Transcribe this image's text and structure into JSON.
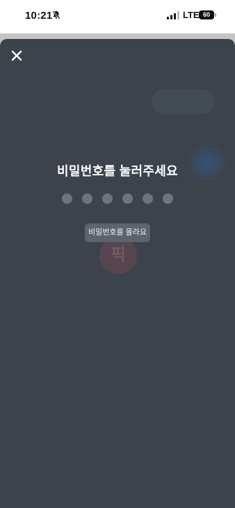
{
  "status_bar": {
    "time": "10:21",
    "network": "LTE",
    "battery": "60"
  },
  "icons": {
    "bell": "bell-slash-icon",
    "signal": "cellular-signal-icon",
    "close": "close-icon"
  },
  "sheet": {
    "title": "비밀번호를 눌러주세요",
    "pin_length": 6,
    "pin_entered": 0,
    "forgot_label": "비밀번호를 몰라요",
    "watermark": "픽"
  },
  "colors": {
    "sheet_background": "#3c434b",
    "dot_empty": "#6c7480",
    "button_background": "#5c646e"
  }
}
